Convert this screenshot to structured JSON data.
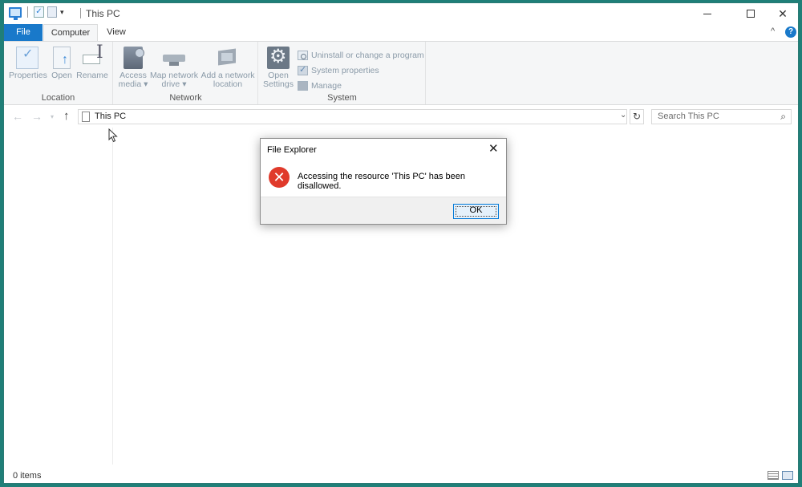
{
  "window": {
    "title": "This PC"
  },
  "ribbon": {
    "tabs": {
      "file": "File",
      "computer": "Computer",
      "view": "View"
    },
    "groups": {
      "location": {
        "label": "Location",
        "buttons": {
          "properties": "Properties",
          "open": "Open",
          "rename": "Rename"
        }
      },
      "network": {
        "label": "Network",
        "buttons": {
          "access_media_1": "Access",
          "access_media_2": "media ▾",
          "map_drive_1": "Map network",
          "map_drive_2": "drive ▾",
          "add_location_1": "Add a network",
          "add_location_2": "location"
        }
      },
      "system": {
        "label": "System",
        "buttons": {
          "open_settings_1": "Open",
          "open_settings_2": "Settings",
          "uninstall": "Uninstall or change a program",
          "system_properties": "System properties",
          "manage": "Manage"
        }
      }
    }
  },
  "address": {
    "path": "This PC",
    "search_placeholder": "Search This PC"
  },
  "status": {
    "items": "0 items"
  },
  "dialog": {
    "title": "File Explorer",
    "message": "Accessing the resource 'This PC' has been disallowed.",
    "ok": "OK"
  },
  "colors": {
    "accent": "#1979ca",
    "error": "#e03a2b",
    "frame": "#1f7f78"
  },
  "icons": [
    "this-pc-icon",
    "properties-icon",
    "open-icon",
    "rename-icon",
    "access-media-icon",
    "map-network-drive-icon",
    "add-network-location-icon",
    "settings-icon",
    "error-icon",
    "search-icon",
    "refresh-icon"
  ]
}
